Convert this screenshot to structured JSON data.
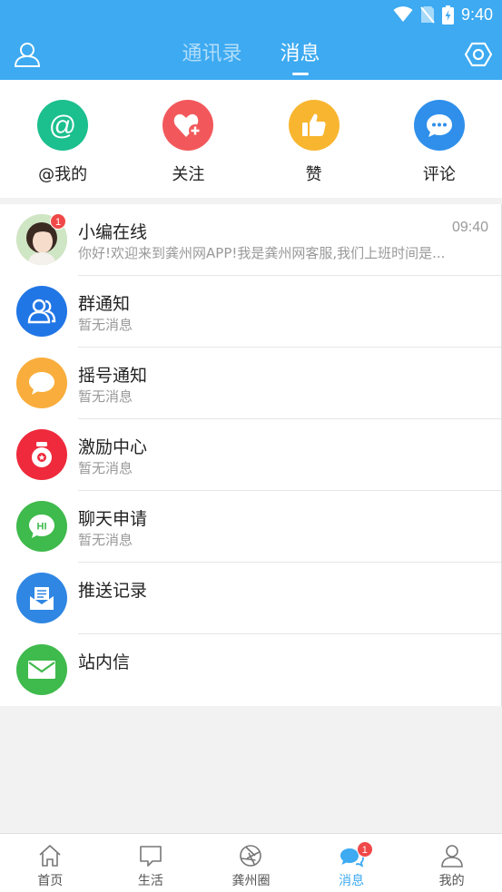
{
  "status_bar": {
    "time": "9:40"
  },
  "header": {
    "tabs": [
      {
        "label": "通讯录",
        "active": false
      },
      {
        "label": "消息",
        "active": true
      }
    ],
    "colors": {
      "bar": "#3daaf1"
    }
  },
  "quick_actions": [
    {
      "label": "@我的",
      "icon": "at-icon",
      "color": "#1cbf8e"
    },
    {
      "label": "关注",
      "icon": "heart-plus-icon",
      "color": "#f2585b"
    },
    {
      "label": "赞",
      "icon": "thumbs-up-icon",
      "color": "#f8b52f"
    },
    {
      "label": "评论",
      "icon": "comment-icon",
      "color": "#2f8fea"
    }
  ],
  "messages": [
    {
      "title": "小编在线",
      "subtitle": "你好!欢迎来到龚州网APP!我是龚州网客服,我们上班时间是...",
      "time": "09:40",
      "badge": "1",
      "icon": "avatar-photo"
    },
    {
      "title": "群通知",
      "subtitle": "暂无消息",
      "icon": "group-icon",
      "color": "#2176e6"
    },
    {
      "title": "摇号通知",
      "subtitle": "暂无消息",
      "icon": "chat-bubble-icon",
      "color": "#f9ad3c"
    },
    {
      "title": "激励中心",
      "subtitle": "暂无消息",
      "icon": "reward-jar-icon",
      "color": "#ee2a3c"
    },
    {
      "title": "聊天申请",
      "subtitle": "暂无消息",
      "icon": "hi-bubble-icon",
      "color": "#3fba4c"
    },
    {
      "title": "推送记录",
      "subtitle": "",
      "icon": "inbox-icon",
      "color": "#2f86e3"
    },
    {
      "title": "站内信",
      "subtitle": "",
      "icon": "mail-icon",
      "color": "#3fba4c"
    }
  ],
  "tab_bar": [
    {
      "label": "首页",
      "icon": "home-icon",
      "active": false
    },
    {
      "label": "生活",
      "icon": "chat-square-icon",
      "active": false
    },
    {
      "label": "龚州圈",
      "icon": "aperture-icon",
      "active": false
    },
    {
      "label": "消息",
      "icon": "message-bubbles-icon",
      "active": true,
      "badge": "1"
    },
    {
      "label": "我的",
      "icon": "person-icon",
      "active": false
    }
  ]
}
